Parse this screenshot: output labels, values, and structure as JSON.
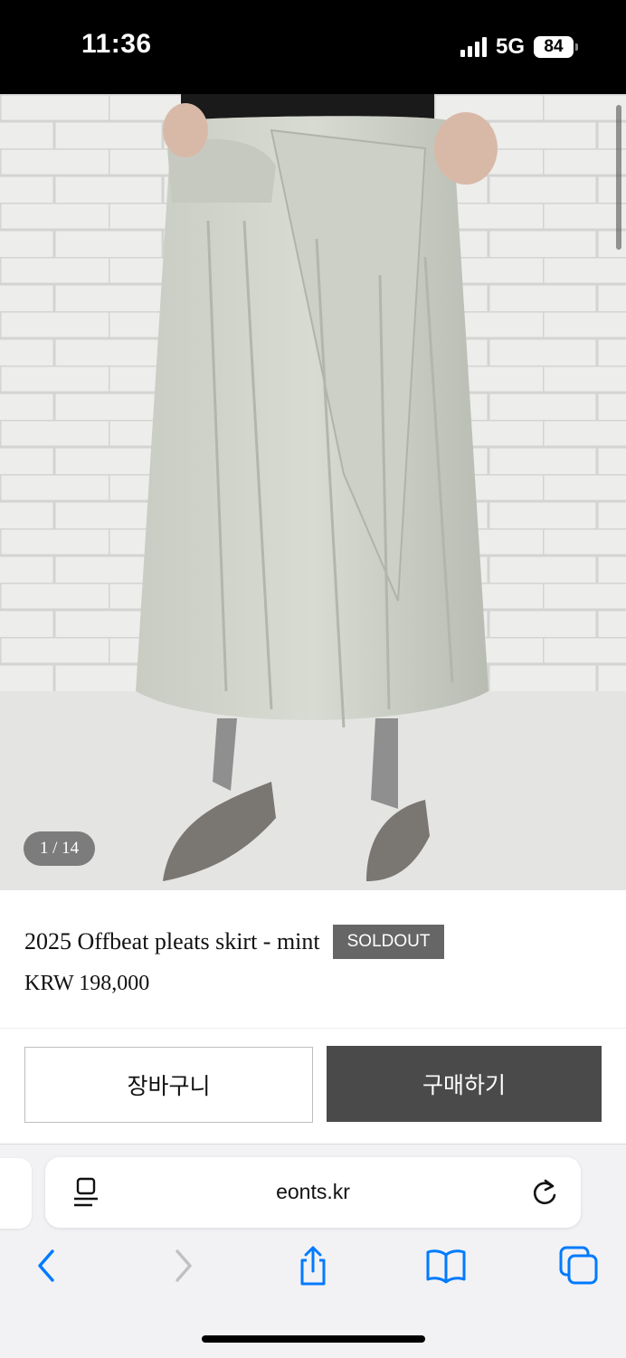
{
  "status_bar": {
    "time": "11:36",
    "network": "5G",
    "battery": "84"
  },
  "gallery": {
    "counter": "1 / 14"
  },
  "product": {
    "title": "2025 Offbeat pleats skirt - mint",
    "badge": "SOLDOUT",
    "price": "KRW 198,000"
  },
  "actions": {
    "cart_label": "장바구니",
    "buy_label": "구매하기"
  },
  "browser": {
    "url": "eonts.kr",
    "icons": [
      "reader-icon",
      "reload-icon",
      "back-icon",
      "forward-icon",
      "share-icon",
      "bookmarks-icon",
      "tabs-icon"
    ]
  },
  "colors": {
    "accent": "#007aff",
    "buy_button": "#4a4a4a",
    "soldout_badge": "#666666"
  }
}
